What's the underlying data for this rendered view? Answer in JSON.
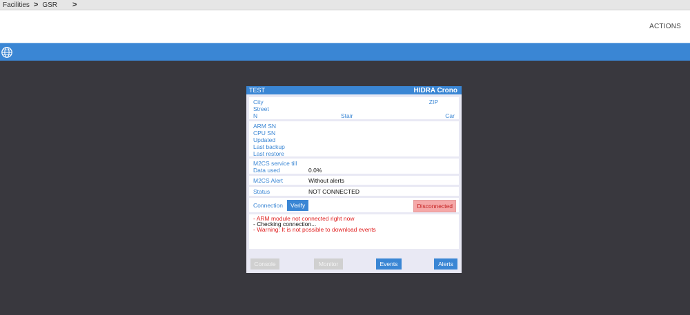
{
  "breadcrumb": {
    "items": [
      "Facilities",
      "GSR"
    ],
    "separator": ">"
  },
  "header": {
    "actions_label": "ACTIONS"
  },
  "bluebar": {
    "icon": "globe-icon",
    "color": "#3a86d4"
  },
  "card": {
    "name": "TEST",
    "brand": "HIDRA Crono",
    "location": {
      "city_label": "City",
      "street_label": "Street",
      "n_label": "N",
      "zip_label": "ZIP",
      "stair_label": "Stair",
      "car_label": "Car"
    },
    "device": {
      "arm_sn_label": "ARM SN",
      "cpu_sn_label": "CPU SN",
      "updated_label": "Updated",
      "last_backup_label": "Last backup",
      "last_restore_label": "Last restore"
    },
    "service": {
      "m2cs_service_label": "M2CS service till",
      "data_used_label": "Data used",
      "data_used_value": "0.0%"
    },
    "alert": {
      "label": "M2CS Alert",
      "value": "Without alerts"
    },
    "status": {
      "label": "Status",
      "value": "NOT CONNECTED"
    },
    "connection": {
      "label": "Connection",
      "verify_label": "Verify",
      "state_label": "Disconnected"
    },
    "log": [
      {
        "text": "- ARM module not connected right now",
        "kind": "error"
      },
      {
        "text": "- Checking connection...",
        "kind": "info"
      },
      {
        "text": "- Warning: It is not possible to download events",
        "kind": "error"
      }
    ],
    "buttons": {
      "console": "Console",
      "monitor": "Monitor",
      "events": "Events",
      "alerts": "Alerts"
    }
  }
}
